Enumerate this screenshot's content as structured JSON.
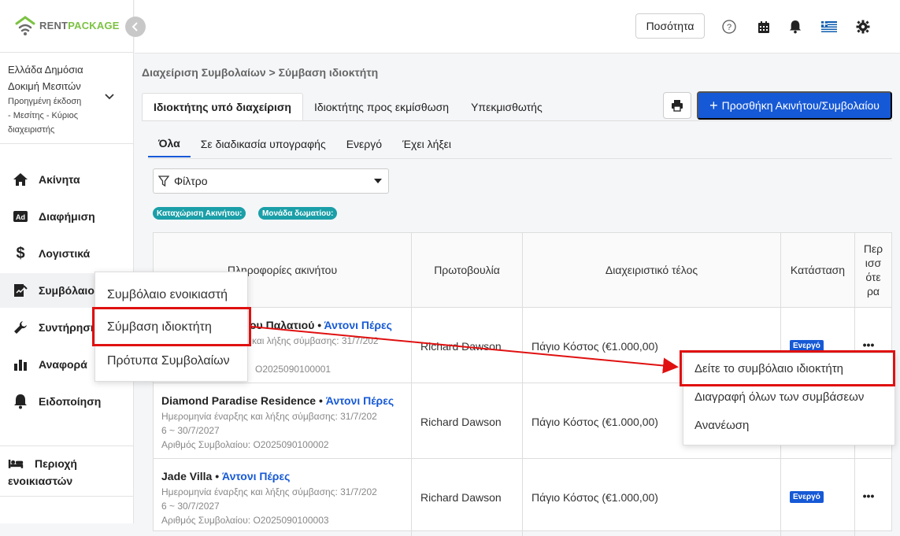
{
  "logo": {
    "part1": "RENT",
    "part2": "PACKAGE"
  },
  "account": {
    "line1": "Ελλάδα Δημόσια",
    "line2": "Δοκιμή Μεσιτών",
    "line3": "Προηγμένη έκδοση",
    "line4": "- Μεσίτης - Κύριος",
    "line5": "διαχειριστής"
  },
  "sidebar": {
    "items": [
      {
        "label": "Ακίνητα",
        "icon": "home-icon"
      },
      {
        "label": "Διαφήμιση",
        "icon": "ad-icon"
      },
      {
        "label": "Λογιστικά",
        "icon": "dollar-icon"
      },
      {
        "label": "Συμβόλαιο",
        "icon": "contract-icon"
      },
      {
        "label": "Συντήρηση",
        "icon": "wrench-icon"
      },
      {
        "label": "Αναφορά",
        "icon": "bar-chart-icon"
      },
      {
        "label": "Ειδοποίηση",
        "icon": "bell-icon"
      }
    ],
    "region_line1": "Περιοχή",
    "region_line2": "ενοικιαστών"
  },
  "topbar": {
    "quantity_label": "Ποσότητα"
  },
  "breadcrumb": "Διαχείριση Συμβολαίων > Σύμβαση ιδιοκτήτη",
  "tabs": [
    {
      "label": "Ιδιοκτήτης υπό διαχείριση",
      "active": true
    },
    {
      "label": "Ιδιοκτήτης προς εκμίσθωση",
      "active": false
    },
    {
      "label": "Υπεκμισθωτής",
      "active": false
    }
  ],
  "add_button_label": "Προσθήκη Ακινήτου/Συμβολαίου",
  "subtabs": [
    {
      "label": "Όλα",
      "active": true
    },
    {
      "label": "Σε διαδικασία υπογραφής",
      "active": false
    },
    {
      "label": "Ενεργό",
      "active": false
    },
    {
      "label": "Έχει λήξει",
      "active": false
    }
  ],
  "filter_label": "Φίλτρο",
  "chips": [
    "Καταχώριση Ακινήτου:",
    "Μονάδα δωματίου:"
  ],
  "table": {
    "headers": {
      "property": "Πληροφορίες ακινήτου",
      "initiative": "Πρωτοβουλία",
      "fee": "Διαχειριστικό τέλος",
      "status": "Κατάσταση",
      "more1": "Περ",
      "more2": "ισσ",
      "more3": "ότε",
      "more4": "ρα"
    },
    "rows": [
      {
        "name": "ου Παλατιού",
        "agent": "Άντονι Πέρες",
        "meta1": "και λήξης σύμβασης: 31/7/202",
        "meta2": "",
        "meta3": "O2025090100001",
        "initiative": "Richard Dawson",
        "fee": "Πάγιο Κόστος (€1.000,00)",
        "status": "Ενεργό"
      },
      {
        "name": "Diamond Paradise Residence",
        "agent": "Άντονι Πέρες",
        "meta1": "Ημερομηνία έναρξης και λήξης σύμβασης: 31/7/202",
        "meta2": "6 ~ 30/7/2027",
        "meta3": "Αριθμός Συμβολαίου: O2025090100002",
        "initiative": "Richard Dawson",
        "fee": "Πάγιο Κόστος (€1.000,00)",
        "status": ""
      },
      {
        "name": "Jade Villa",
        "agent": "Άντονι Πέρες",
        "meta1": "Ημερομηνία έναρξης και λήξης σύμβασης: 31/7/202",
        "meta2": "6 ~ 30/7/2027",
        "meta3": "Αριθμός Συμβολαίου: O2025090100003",
        "initiative": "Richard Dawson",
        "fee": "Πάγιο Κόστος (€1.000,00)",
        "status": "Ενεργό"
      }
    ]
  },
  "contract_menu": [
    "Συμβόλαιο ενοικιαστή",
    "Σύμβαση ιδιοκτήτη",
    "Πρότυπα Συμβολαίων"
  ],
  "row_menu": [
    "Δείτε το συμβόλαιο ιδιοκτήτη",
    "Διαγραφή όλων των συμβάσεων",
    "Ανανέωση"
  ],
  "colors": {
    "accent": "#1659d6",
    "highlight": "#e01010",
    "chip": "#1b9fa8",
    "brand_green": "#7cc242"
  }
}
